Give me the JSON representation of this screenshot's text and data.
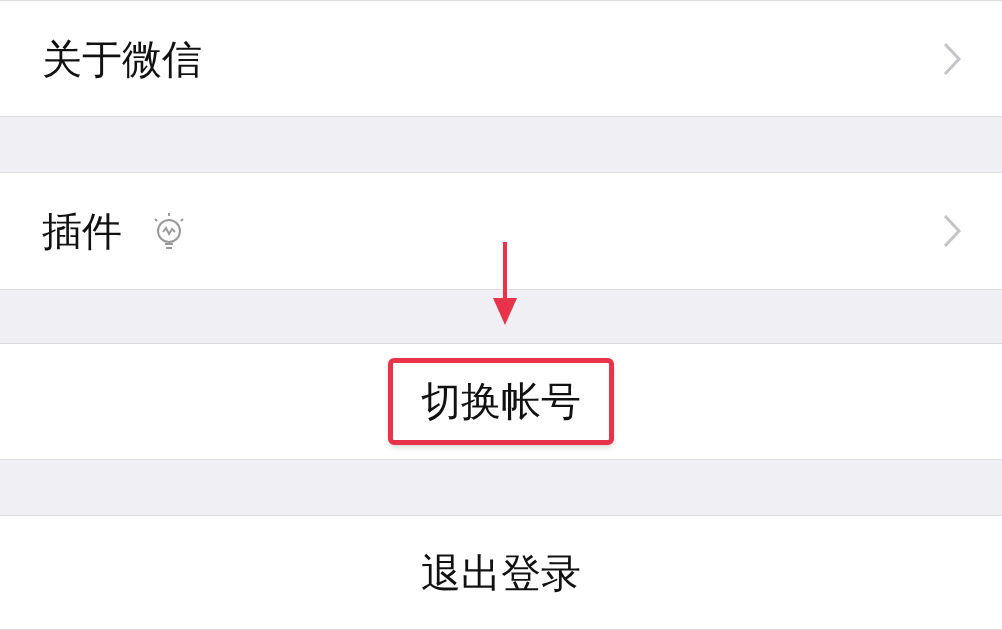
{
  "items": [
    {
      "kind": "nav",
      "label": "关于微信",
      "icon": false
    },
    {
      "kind": "nav",
      "label": "插件",
      "icon": true
    },
    {
      "kind": "action",
      "label": "切换帐号",
      "highlighted": true
    },
    {
      "kind": "action",
      "label": "退出登录",
      "highlighted": false
    }
  ]
}
